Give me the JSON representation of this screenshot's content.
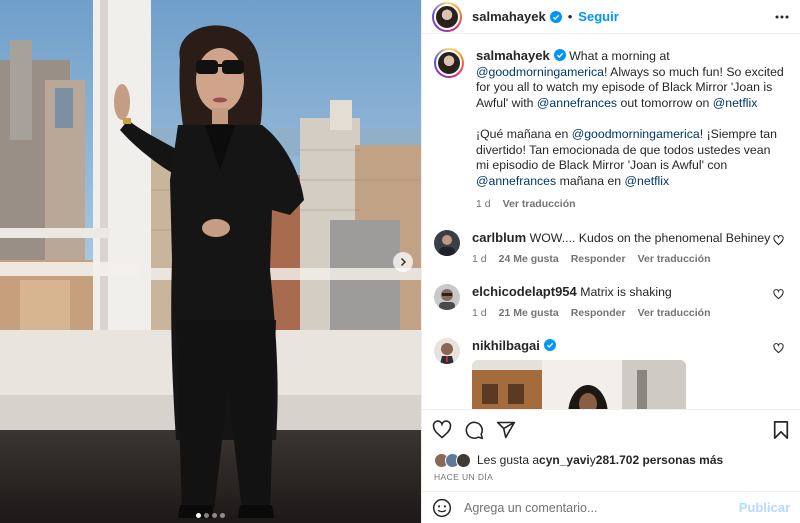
{
  "post": {
    "author": "salmahayek",
    "follow_label": "Seguir",
    "separator": "•",
    "caption_en": "What a morning at @goodmorningamerica! Always so much fun! So excited for you all to watch my episode of Black Mirror 'Joan is Awful' with @annefrances out tomorrow on @netflix",
    "caption_es": "¡Qué mañana en @goodmorningamerica! ¡Siempre tan divertido! Tan emocionada de que todos ustedes vean mi episodio de Black Mirror 'Joan is Awful' con @annefrances mañana en @netflix",
    "caption_time": "1 d",
    "see_translation": "Ver traducción",
    "carousel": {
      "count": 4,
      "active": 0
    }
  },
  "comments": [
    {
      "user": "carlblum",
      "text": "WOW.... Kudos on the phenomenal Behiney",
      "time": "1 d",
      "likes": "24 Me gusta",
      "reply": "Responder",
      "translate": "Ver traducción",
      "avatar_color": "#3b3f44"
    },
    {
      "user": "elchicodelapt954",
      "text": "Matrix is shaking",
      "time": "1 d",
      "likes": "21 Me gusta",
      "reply": "Responder",
      "translate": "Ver traducción",
      "avatar_color": "#8f8f8f"
    },
    {
      "user": "nikhilbagai",
      "text": "",
      "verified": true,
      "avatar_color": "#6b4a3a"
    }
  ],
  "likes_line": {
    "prefix": "Les gusta a ",
    "user": "cyn_yavi",
    "middle": " y ",
    "count": "281.702 personas más"
  },
  "time_ago": "HACE UN DÍA",
  "add_comment": {
    "placeholder": "Agrega un comentario...",
    "publish_label": "Publicar"
  },
  "colors": {
    "accent": "#0095f6",
    "mention": "#00376b",
    "muted": "#737373",
    "publish_disabled": "#b3dbff"
  },
  "icons": [
    "verified-badge-icon",
    "more-options-icon",
    "heart-icon",
    "comment-icon",
    "share-icon",
    "bookmark-icon",
    "emoji-icon",
    "chevron-right-icon"
  ]
}
